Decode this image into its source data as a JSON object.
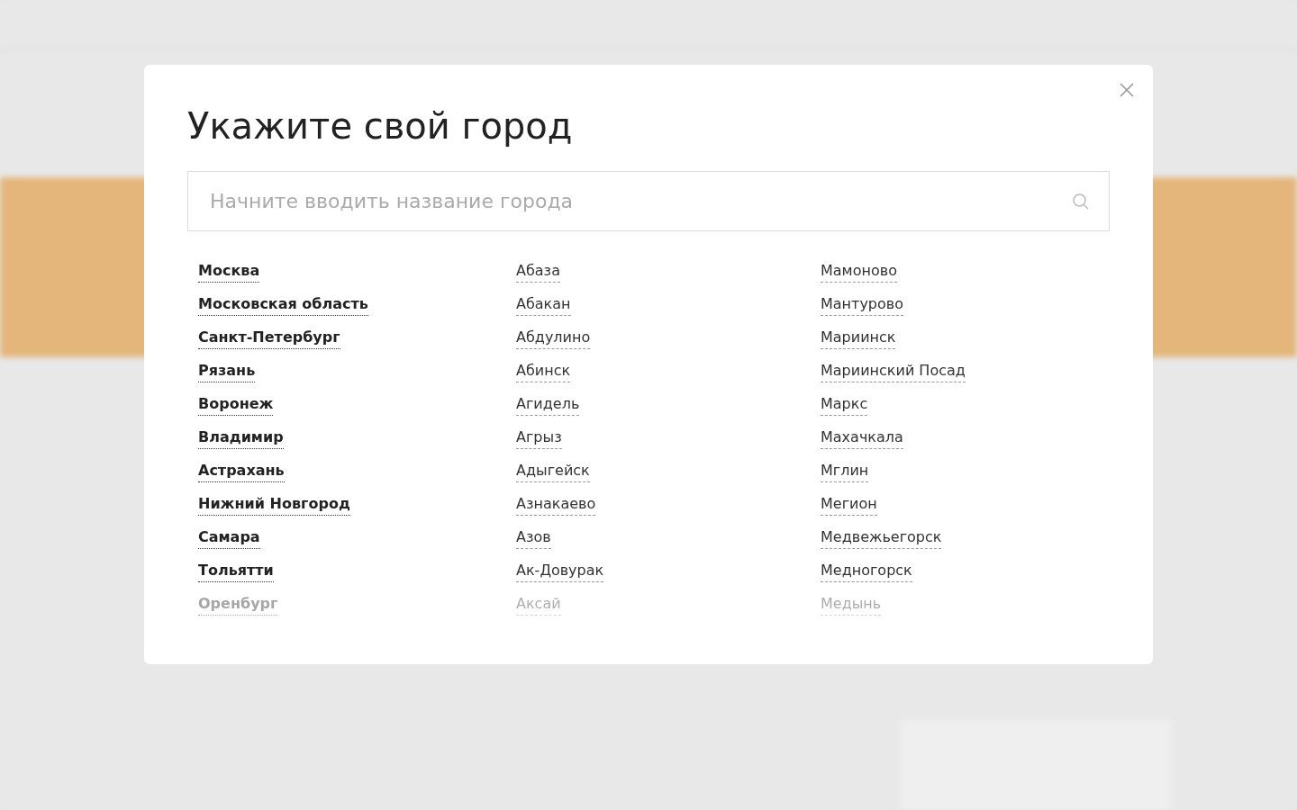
{
  "dialog": {
    "title": "Укажите свой город",
    "search": {
      "placeholder": "Начните вводить название города"
    },
    "columns": [
      {
        "bold": true,
        "cities": [
          "Москва",
          "Московская область",
          "Санкт-Петербург",
          "Рязань",
          "Воронеж",
          "Владимир",
          "Астрахань",
          "Нижний Новгород",
          "Самара",
          "Тольятти",
          "Оренбург"
        ]
      },
      {
        "bold": false,
        "cities": [
          "Абаза",
          "Абакан",
          "Абдулино",
          "Абинск",
          "Агидель",
          "Агрыз",
          "Адыгейск",
          "Азнакаево",
          "Азов",
          "Ак-Довурак",
          "Аксай"
        ]
      },
      {
        "bold": false,
        "cities": [
          "Мамоново",
          "Мантурово",
          "Мариинск",
          "Мариинский Посад",
          "Маркс",
          "Махачкала",
          "Мглин",
          "Мегион",
          "Медвежьегорск",
          "Медногорск",
          "Медынь"
        ]
      }
    ]
  }
}
